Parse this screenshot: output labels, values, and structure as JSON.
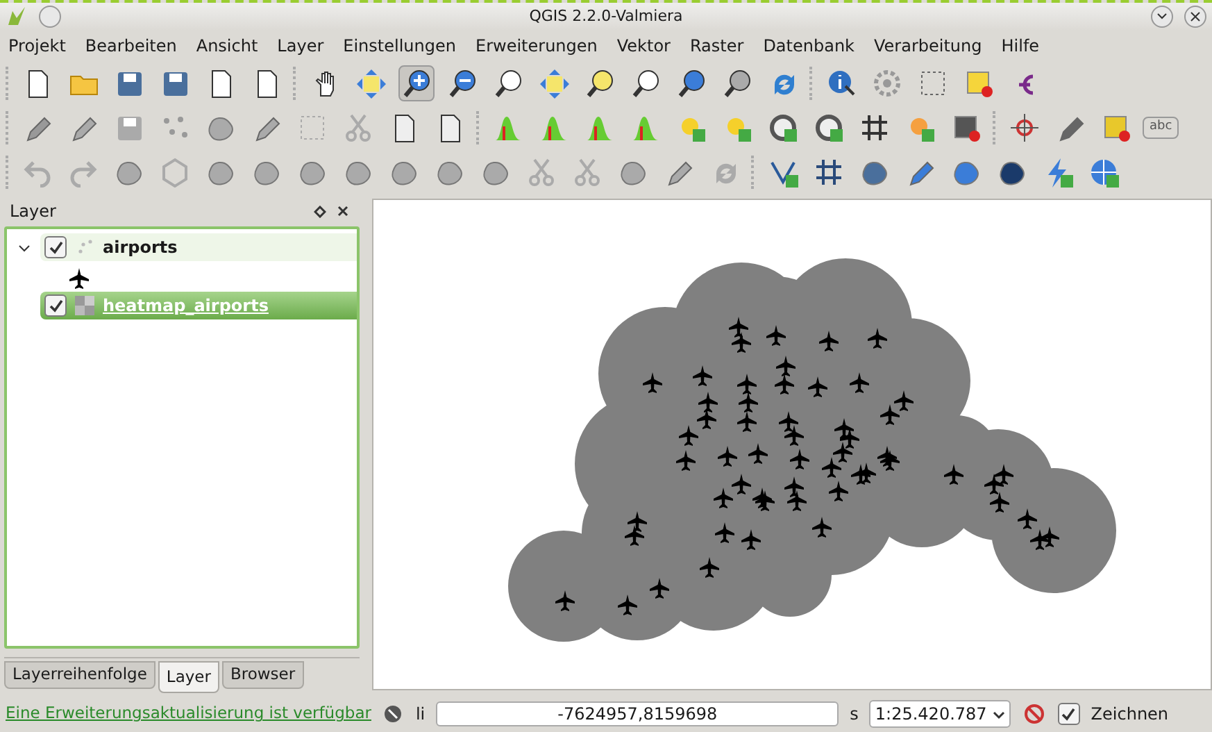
{
  "window": {
    "title": "QGIS 2.2.0-Valmiera"
  },
  "menu": [
    {
      "label": "Projekt"
    },
    {
      "label": "Bearbeiten"
    },
    {
      "label": "Ansicht"
    },
    {
      "label": "Layer"
    },
    {
      "label": "Einstellungen"
    },
    {
      "label": "Erweiterungen"
    },
    {
      "label": "Vektor"
    },
    {
      "label": "Raster"
    },
    {
      "label": "Datenbank"
    },
    {
      "label": "Verarbeitung"
    },
    {
      "label": "Hilfe"
    }
  ],
  "toolbar": {
    "label_tool": "abc"
  },
  "layer_panel": {
    "title": "Layer",
    "layers": [
      {
        "name": "airports",
        "kind": "point",
        "checked": true,
        "selected": false
      },
      {
        "name": "heatmap_airports",
        "kind": "raster",
        "checked": true,
        "selected": true
      }
    ]
  },
  "panel_tabs": [
    {
      "label": "Layerreihenfolge",
      "selected": false
    },
    {
      "label": "Layer",
      "selected": true
    },
    {
      "label": "Browser",
      "selected": false
    }
  ],
  "status_bar": {
    "message": "Eine Erweiterungsaktualisierung ist verfügbar",
    "coordinate_label": "li",
    "coordinate": "-7624957,8159698",
    "scale_label": "s",
    "scale": "1:25.420.787",
    "render_label": "Zeichnen",
    "render_checked": true
  }
}
